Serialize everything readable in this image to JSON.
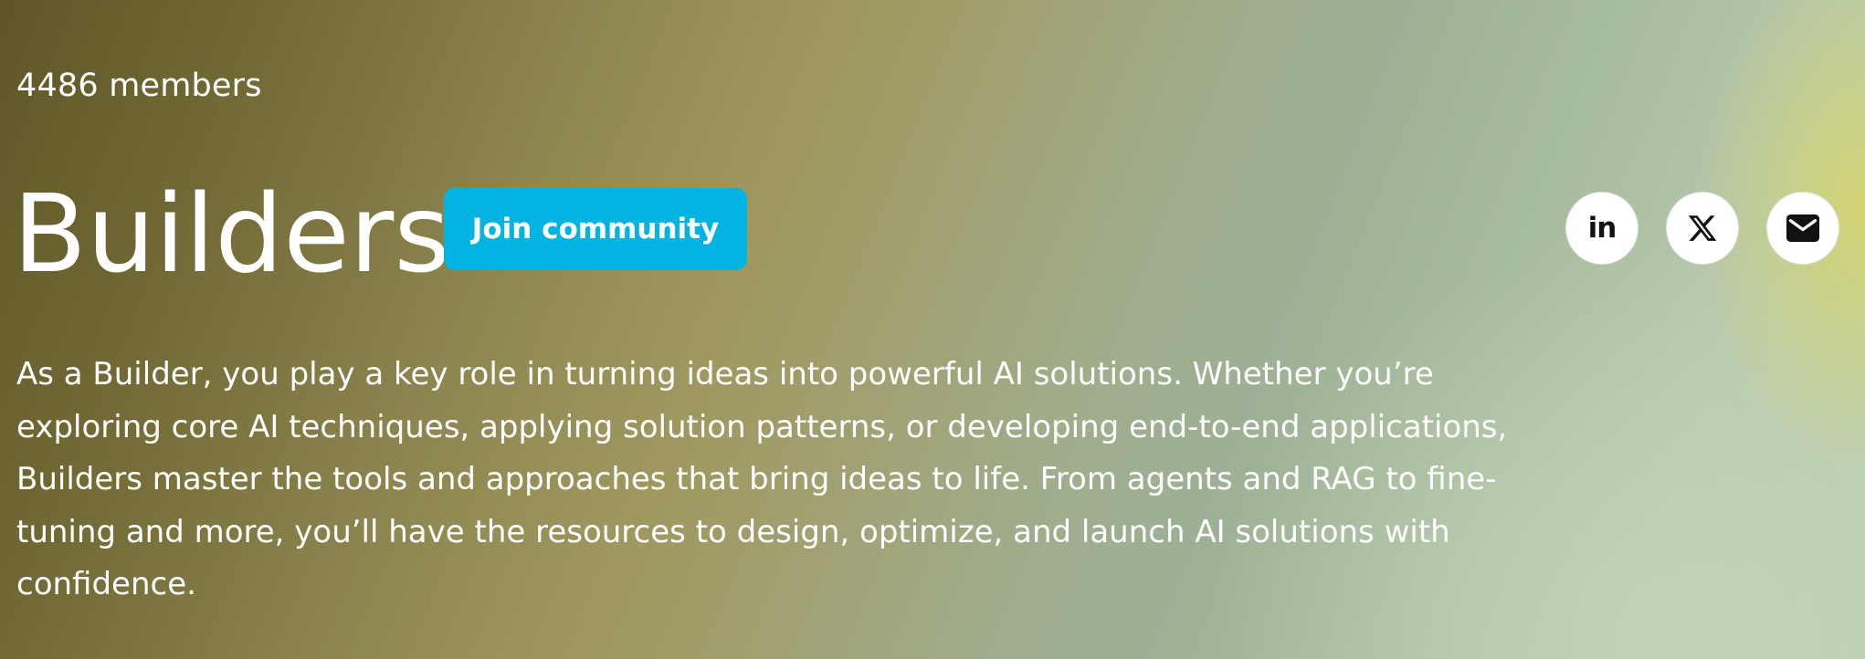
{
  "community": {
    "members_text": "4486 members",
    "title": "Builders",
    "join_label": "Join community",
    "description": "As a Builder, you play a key role in turning ideas into powerful AI solutions. Whether you’re exploring core AI techniques, applying solution patterns, or developing end-to-end applications, Builders master the tools and approaches that bring ideas to life. From agents and RAG to fine-tuning and more, you’ll have the resources to design, optimize, and launch AI solutions with confidence."
  },
  "social": {
    "linkedin_text": "in",
    "icons": [
      "linkedin-icon",
      "x-icon",
      "mail-icon"
    ]
  },
  "colors": {
    "join_button": "#03b3e1",
    "text": "#ffffff",
    "icon": "#111111"
  }
}
